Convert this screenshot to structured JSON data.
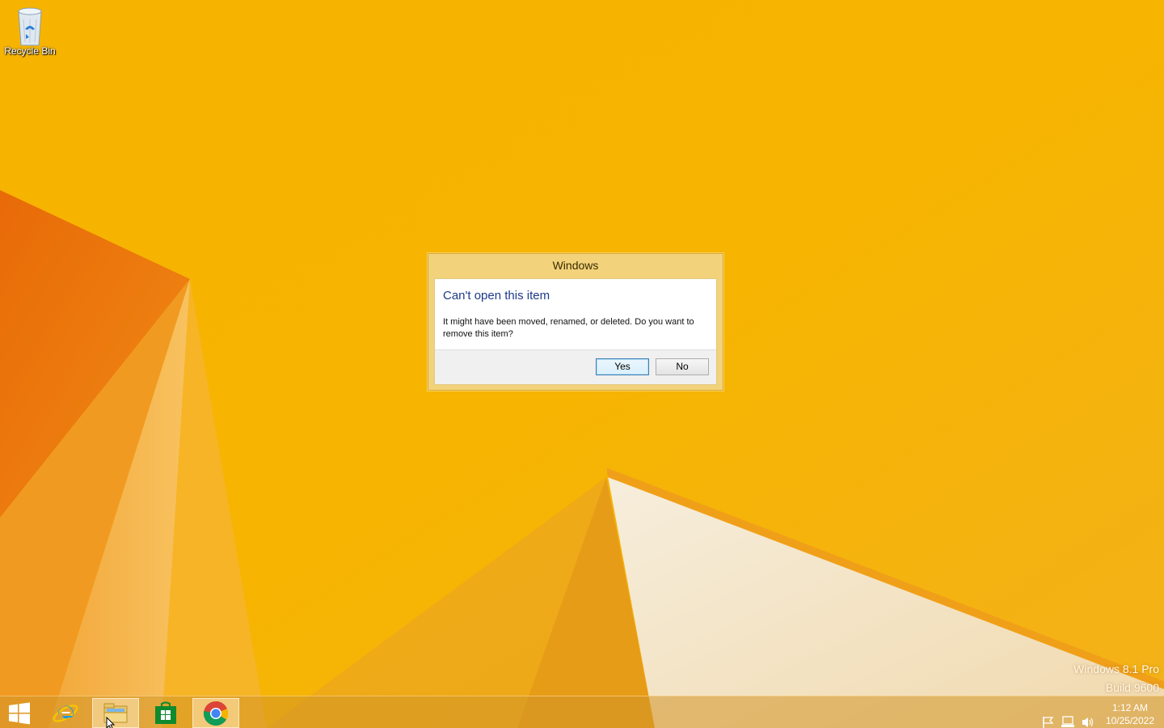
{
  "desktop": {
    "icons": [
      {
        "label": "Recycle Bin",
        "icon": "recycle-bin-icon"
      }
    ],
    "watermark": {
      "line1": "Windows 8.1 Pro",
      "line2": "Build 9600"
    },
    "colors": {
      "wallpaper_yellow": "#F5B400",
      "wallpaper_orange": "#E87A10"
    }
  },
  "dialog": {
    "title": "Windows",
    "heading": "Can't open this item",
    "message": "It might have been moved, renamed, or deleted. Do you want to remove this item?",
    "buttons": {
      "yes": "Yes",
      "no": "No"
    },
    "heading_color": "#1E3A8A"
  },
  "taskbar": {
    "start_icon": "windows-start-icon",
    "pinned": [
      {
        "name": "Internet Explorer",
        "icon": "internet-explorer-icon"
      },
      {
        "name": "File Explorer",
        "icon": "file-explorer-icon",
        "active": true
      },
      {
        "name": "Store",
        "icon": "windows-store-icon"
      },
      {
        "name": "Google Chrome",
        "icon": "chrome-icon",
        "active": true
      }
    ],
    "tray": {
      "icons": [
        "action-center-flag-icon",
        "network-icon",
        "volume-icon"
      ],
      "time": "1:12 AM",
      "date": "10/25/2022"
    }
  }
}
